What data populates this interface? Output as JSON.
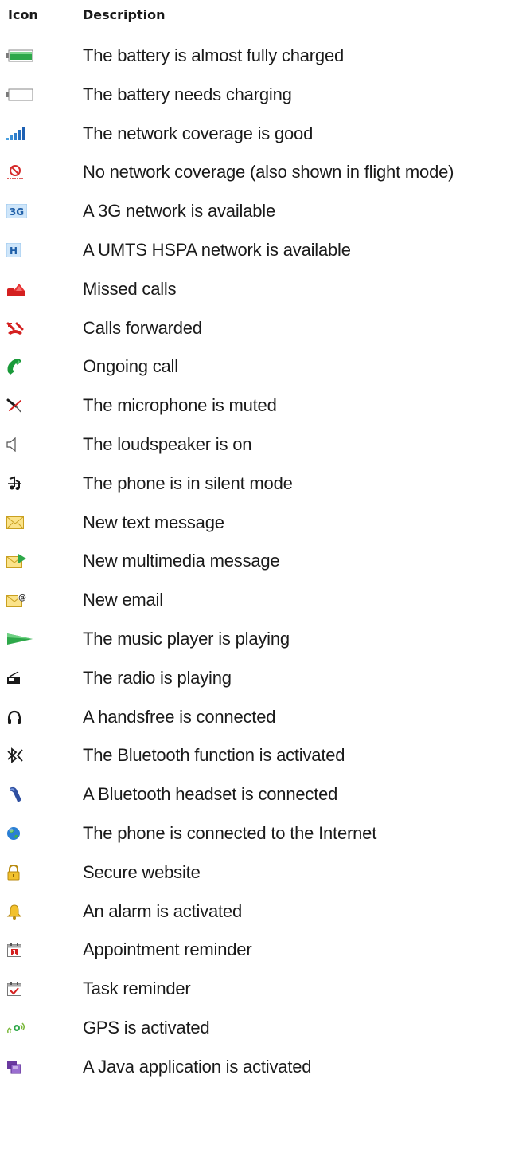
{
  "header": {
    "icon_col": "Icon",
    "desc_col": "Description"
  },
  "rows": [
    {
      "icon": "battery-full-icon",
      "description": "The battery is almost fully charged"
    },
    {
      "icon": "battery-empty-icon",
      "description": "The battery needs charging"
    },
    {
      "icon": "signal-strength-icon",
      "description": "The network coverage is good"
    },
    {
      "icon": "no-network-icon",
      "description": "No network coverage (also shown in flight mode)"
    },
    {
      "icon": "3g-network-icon",
      "description": "A 3G network is available"
    },
    {
      "icon": "hspa-network-icon",
      "description": "A UMTS HSPA network is available"
    },
    {
      "icon": "missed-call-icon",
      "description": "Missed calls"
    },
    {
      "icon": "call-forward-icon",
      "description": "Calls forwarded"
    },
    {
      "icon": "ongoing-call-icon",
      "description": "Ongoing call"
    },
    {
      "icon": "mic-muted-icon",
      "description": "The microphone is muted"
    },
    {
      "icon": "loudspeaker-icon",
      "description": "The loudspeaker is on"
    },
    {
      "icon": "silent-mode-icon",
      "description": "The phone is in silent mode"
    },
    {
      "icon": "text-message-icon",
      "description": "New text message"
    },
    {
      "icon": "multimedia-message-icon",
      "description": "New multimedia message"
    },
    {
      "icon": "email-icon",
      "description": "New email"
    },
    {
      "icon": "music-play-icon",
      "description": "The music player is playing"
    },
    {
      "icon": "radio-icon",
      "description": "The radio is playing"
    },
    {
      "icon": "handsfree-icon",
      "description": "A handsfree is connected"
    },
    {
      "icon": "bluetooth-icon",
      "description": "The Bluetooth function is activated"
    },
    {
      "icon": "bluetooth-headset-icon",
      "description": "A Bluetooth headset is connected"
    },
    {
      "icon": "internet-globe-icon",
      "description": "The phone is connected to the Internet"
    },
    {
      "icon": "padlock-icon",
      "description": "Secure website"
    },
    {
      "icon": "alarm-bell-icon",
      "description": "An alarm is activated"
    },
    {
      "icon": "appointment-calendar-icon",
      "description": "Appointment reminder"
    },
    {
      "icon": "task-reminder-icon",
      "description": "Task reminder"
    },
    {
      "icon": "gps-icon",
      "description": "GPS is activated"
    },
    {
      "icon": "java-app-icon",
      "description": "A Java application is activated"
    }
  ]
}
